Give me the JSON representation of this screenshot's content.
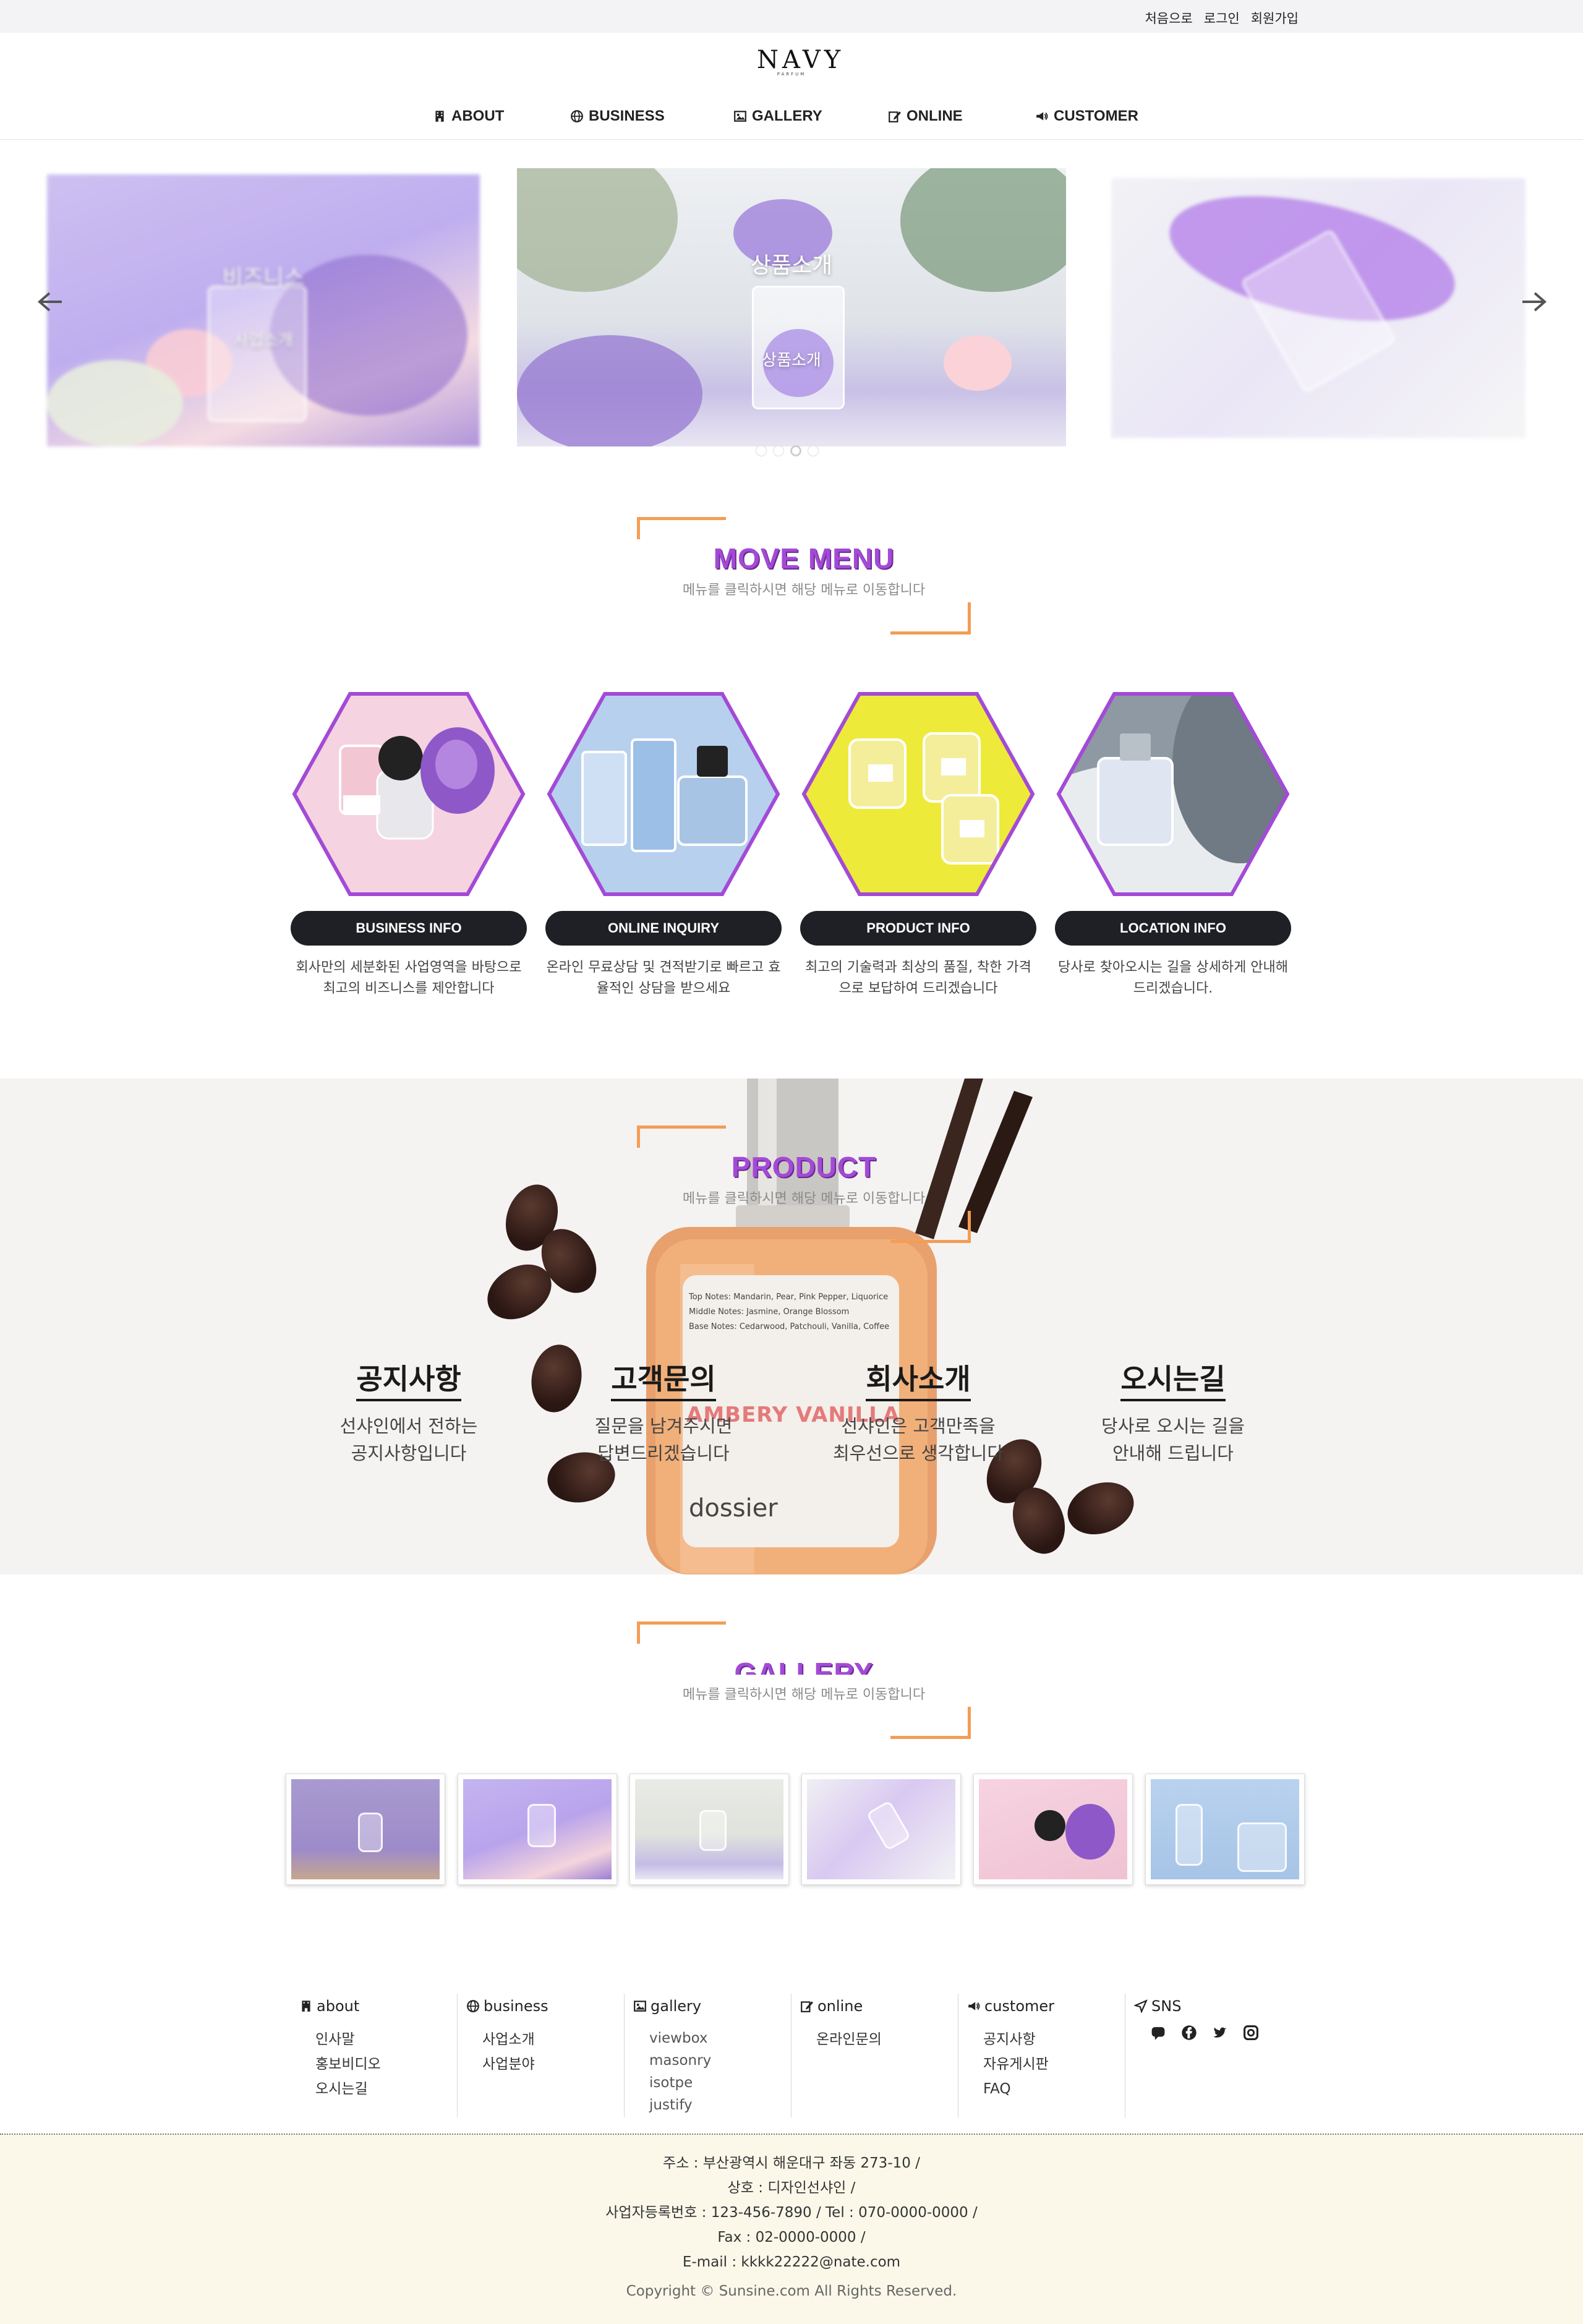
{
  "topbar": {
    "home": "처음으로",
    "login": "로그인",
    "join": "회원가입"
  },
  "logo": {
    "word": "NAVY",
    "sub": "PARFUM"
  },
  "gnb": [
    {
      "label": "ABOUT",
      "icon": "building-icon"
    },
    {
      "label": "BUSINESS",
      "icon": "globe-icon"
    },
    {
      "label": "GALLERY",
      "icon": "image-icon"
    },
    {
      "label": "ONLINE",
      "icon": "edit-icon"
    },
    {
      "label": "CUSTOMER",
      "icon": "megaphone-icon"
    }
  ],
  "slider": {
    "slides": [
      {
        "title": "비즈니스",
        "caption": "사업소개"
      },
      {
        "title": "상품소개",
        "caption": "상품소개"
      },
      {
        "title": "",
        "caption": ""
      }
    ],
    "dots": 4,
    "active_dot": 2
  },
  "move_menu": {
    "title": "MOVE MENU",
    "desc": "메뉴를 클릭하시면 해당 메뉴로 이동합니다",
    "cards": [
      {
        "label": "BUSINESS INFO",
        "text": "회사만의 세분화된 사업영역을 바탕으로 최고의 비즈니스를 제안합니다"
      },
      {
        "label": "ONLINE INQUIRY",
        "text": "온라인 무료상담 및 견적받기로 빠르고 효율적인 상담을 받으세요"
      },
      {
        "label": "PRODUCT INFO",
        "text": "최고의 기술력과 최상의 품질, 착한 가격으로 보답하여 드리겠습니다"
      },
      {
        "label": "LOCATION INFO",
        "text": "당사로 찾아오시는 길을 상세하게 안내해 드리겠습니다."
      }
    ]
  },
  "product": {
    "title": "PRODUCT",
    "desc": "메뉴를 클릭하시면 해당 메뉴로 이동합니다",
    "bottle_label": [
      "Top Notes: Mandarin, Pear, Pink Pepper, Liquorice",
      "Middle Notes: Jasmine, Orange Blossom",
      "Base Notes: Cedarwood, Patchouli, Vanilla, Coffee"
    ],
    "bottle_name": "AMBERY VANILLA",
    "bottle_brand": "dossier",
    "columns": [
      {
        "title": "공지사항",
        "text": [
          "선샤인에서 전하는",
          "공지사항입니다"
        ]
      },
      {
        "title": "고객문의",
        "text": [
          "질문을 남겨주시면",
          "답변드리겠습니다"
        ]
      },
      {
        "title": "회사소개",
        "text": [
          "선샤인은 고객만족을",
          "최우선으로 생각합니다"
        ]
      },
      {
        "title": "오시는길",
        "text": [
          "당사로 오시는 길을",
          "안내해 드립니다"
        ]
      }
    ]
  },
  "gallery": {
    "title": "GALLERY",
    "desc": "메뉴를 클릭하시면 해당 메뉴로 이동합니다",
    "thumbs": 6
  },
  "footer_nav": [
    {
      "title": "about",
      "icon": "building-icon",
      "items": [
        "인사말",
        "홍보비디오",
        "오시는길"
      ]
    },
    {
      "title": "business",
      "icon": "globe-icon",
      "items": [
        "사업소개",
        "사업분야"
      ]
    },
    {
      "title": "gallery",
      "icon": "image-icon",
      "items": [
        "viewbox",
        "masonry",
        "isotpe",
        "justify"
      ]
    },
    {
      "title": "online",
      "icon": "edit-icon",
      "items": [
        "온라인문의"
      ]
    },
    {
      "title": "customer",
      "icon": "megaphone-icon",
      "items": [
        "공지사항",
        "자유게시판",
        "FAQ"
      ]
    },
    {
      "title": "SNS",
      "icon": "send-icon",
      "items": []
    }
  ],
  "footer_info": {
    "address": "주소 : 부산광역시 해운대구 좌동 273-10 /",
    "company": "상호 : 디자인선샤인 /",
    "biz": "사업자등록번호 : 123-456-7890 / Tel : 070-0000-0000 /",
    "fax": "Fax : 02-0000-0000 /",
    "email": "E-mail : kkkk22222@nate.com",
    "copyright": "Copyright © Sunsine.com All Rights Reserved."
  },
  "colors": {
    "accent": "#a34ad6",
    "bracket": "#f39d55",
    "pill": "#1f1f26",
    "footer_bg": "#fbf8ea"
  }
}
